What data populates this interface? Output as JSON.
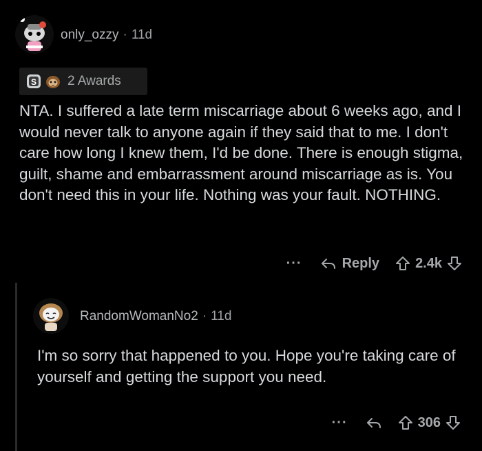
{
  "comments": [
    {
      "username": "only_ozzy",
      "separator": "·",
      "age": "11d",
      "awards": {
        "count_label": "2 Awards",
        "icons": [
          "silver-award-icon",
          "sloth-award-icon"
        ]
      },
      "body": "NTA. I suffered a late term miscarriage about 6 weeks ago,  and I would never talk to anyone again if they said that to me.  I don't care how long I knew them,  I'd be done.  There is enough stigma, guilt,  shame and embarrassment around miscarriage as is.  You don't need this in your life.  Nothing was your fault. NOTHING.",
      "actions": {
        "more": "···",
        "reply_label": "Reply",
        "score": "2.4k"
      }
    },
    {
      "username": "RandomWomanNo2",
      "separator": "·",
      "age": "11d",
      "body": "I'm so sorry that happened to you. Hope you're taking care of yourself  and getting the support you need.",
      "actions": {
        "more": "···",
        "score": "306"
      }
    }
  ],
  "colors": {
    "background": "#000000",
    "text": "#d7dadc",
    "muted": "#a6a9ab",
    "award_bg": "#1b1b1b"
  }
}
